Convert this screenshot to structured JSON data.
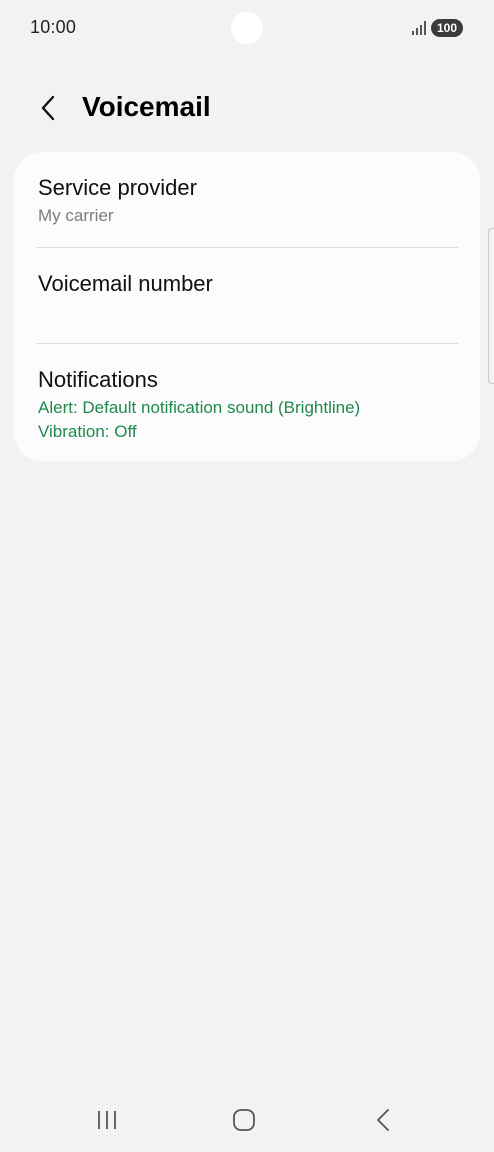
{
  "status_bar": {
    "time": "10:00",
    "battery": "100"
  },
  "header": {
    "title": "Voicemail"
  },
  "settings": {
    "items": [
      {
        "title": "Service provider",
        "subtitle": "My carrier"
      },
      {
        "title": "Voicemail number"
      },
      {
        "title": "Notifications",
        "alert": "Alert: Default notification sound (Brightline)",
        "vibration": "Vibration: Off"
      }
    ]
  },
  "colors": {
    "background": "#f2f2f4",
    "card": "#fcfcfe",
    "accent_green": "#1f8a4c",
    "secondary_text": "#7c7c7c"
  },
  "icons": {
    "back": "chevron-left-icon",
    "signal": "signal-icon",
    "nav_recents": "recents-icon",
    "nav_home": "home-icon",
    "nav_back": "back-icon"
  }
}
